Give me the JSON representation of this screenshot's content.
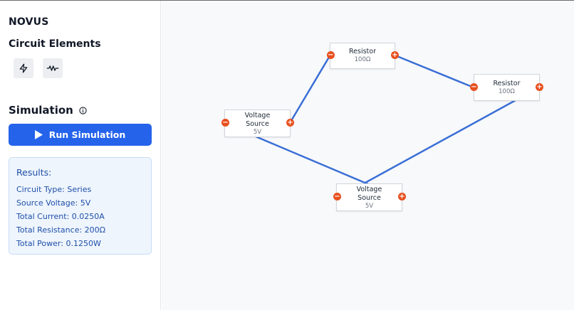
{
  "app": {
    "brand": "NOVUS"
  },
  "sidebar": {
    "elements_title": "Circuit Elements",
    "element_buttons": [
      {
        "icon": "voltage-source-icon"
      },
      {
        "icon": "resistor-icon"
      }
    ],
    "simulation_title": "Simulation",
    "run_label": "Run Simulation",
    "results": {
      "title": "Results:",
      "lines": [
        "Circuit Type: Series",
        "Source Voltage: 5V",
        "Total Current: 0.0250A",
        "Total Resistance: 200Ω",
        "Total Power: 0.1250W"
      ]
    }
  },
  "canvas": {
    "nodes": [
      {
        "label": "Resistor",
        "value": "100Ω"
      },
      {
        "label": "Resistor",
        "value": "100Ω"
      },
      {
        "label": "Voltage Source",
        "value": "5V"
      },
      {
        "label": "Voltage Source",
        "value": "5V"
      }
    ],
    "port_neg": "−",
    "port_pos": "+"
  },
  "colors": {
    "accent": "#2563eb",
    "port": "#e8501e",
    "wire": "#3b6fd6",
    "results_bg": "#eef5fd"
  }
}
